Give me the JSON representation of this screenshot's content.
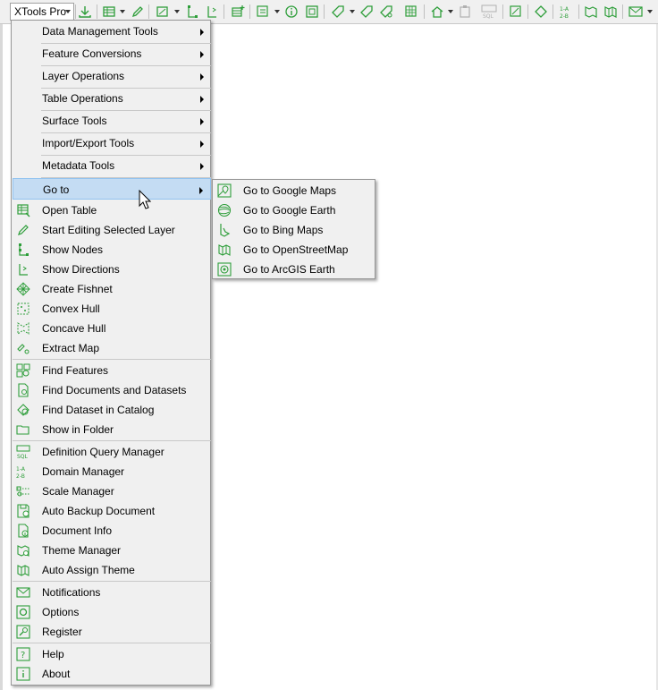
{
  "toolbar": {
    "main_label": "XTools Pro",
    "accent": "#2e9e3a"
  },
  "menu": {
    "submenus": [
      {
        "label": "Data Management Tools"
      },
      {
        "label": "Feature Conversions"
      },
      {
        "label": "Layer Operations"
      },
      {
        "label": "Table Operations"
      },
      {
        "label": "Surface Tools"
      },
      {
        "label": "Import/Export Tools"
      },
      {
        "label": "Metadata Tools"
      },
      {
        "label": "Go to"
      }
    ],
    "items": [
      {
        "label": "Open Table",
        "icon": "open-table-icon"
      },
      {
        "label": "Start Editing Selected Layer",
        "icon": "pencil-icon"
      },
      {
        "label": "Show Nodes",
        "icon": "nodes-icon"
      },
      {
        "label": "Show Directions",
        "icon": "directions-icon"
      },
      {
        "label": "Create Fishnet",
        "icon": "fishnet-icon"
      },
      {
        "label": "Convex Hull",
        "icon": "convex-hull-icon"
      },
      {
        "label": "Concave Hull",
        "icon": "concave-hull-icon"
      },
      {
        "label": "Extract Map",
        "icon": "extract-map-icon"
      },
      {
        "label": "Find Features",
        "icon": "find-features-icon"
      },
      {
        "label": "Find Documents and Datasets",
        "icon": "find-documents-icon"
      },
      {
        "label": "Find Dataset in Catalog",
        "icon": "find-dataset-icon"
      },
      {
        "label": "Show in Folder",
        "icon": "folder-icon"
      },
      {
        "label": "Definition Query Manager",
        "icon": "sql-icon"
      },
      {
        "label": "Domain Manager",
        "icon": "domain-icon"
      },
      {
        "label": "Scale Manager",
        "icon": "scale-icon"
      },
      {
        "label": "Auto Backup Document",
        "icon": "backup-icon"
      },
      {
        "label": "Document Info",
        "icon": "document-info-icon"
      },
      {
        "label": "Theme Manager",
        "icon": "theme-icon"
      },
      {
        "label": "Auto Assign Theme",
        "icon": "auto-theme-icon"
      },
      {
        "label": "Notifications",
        "icon": "envelope-icon"
      },
      {
        "label": "Options",
        "icon": "options-icon"
      },
      {
        "label": "Register",
        "icon": "register-icon"
      },
      {
        "label": "Help",
        "icon": "help-icon"
      },
      {
        "label": "About",
        "icon": "about-icon"
      }
    ]
  },
  "goto_submenu": {
    "items": [
      {
        "label": "Go to Google Maps",
        "icon": "google-maps-icon"
      },
      {
        "label": "Go to Google Earth",
        "icon": "google-earth-icon"
      },
      {
        "label": "Go to Bing Maps",
        "icon": "bing-maps-icon"
      },
      {
        "label": "Go to OpenStreetMap",
        "icon": "openstreetmap-icon"
      },
      {
        "label": "Go to ArcGIS Earth",
        "icon": "arcgis-earth-icon"
      }
    ]
  }
}
